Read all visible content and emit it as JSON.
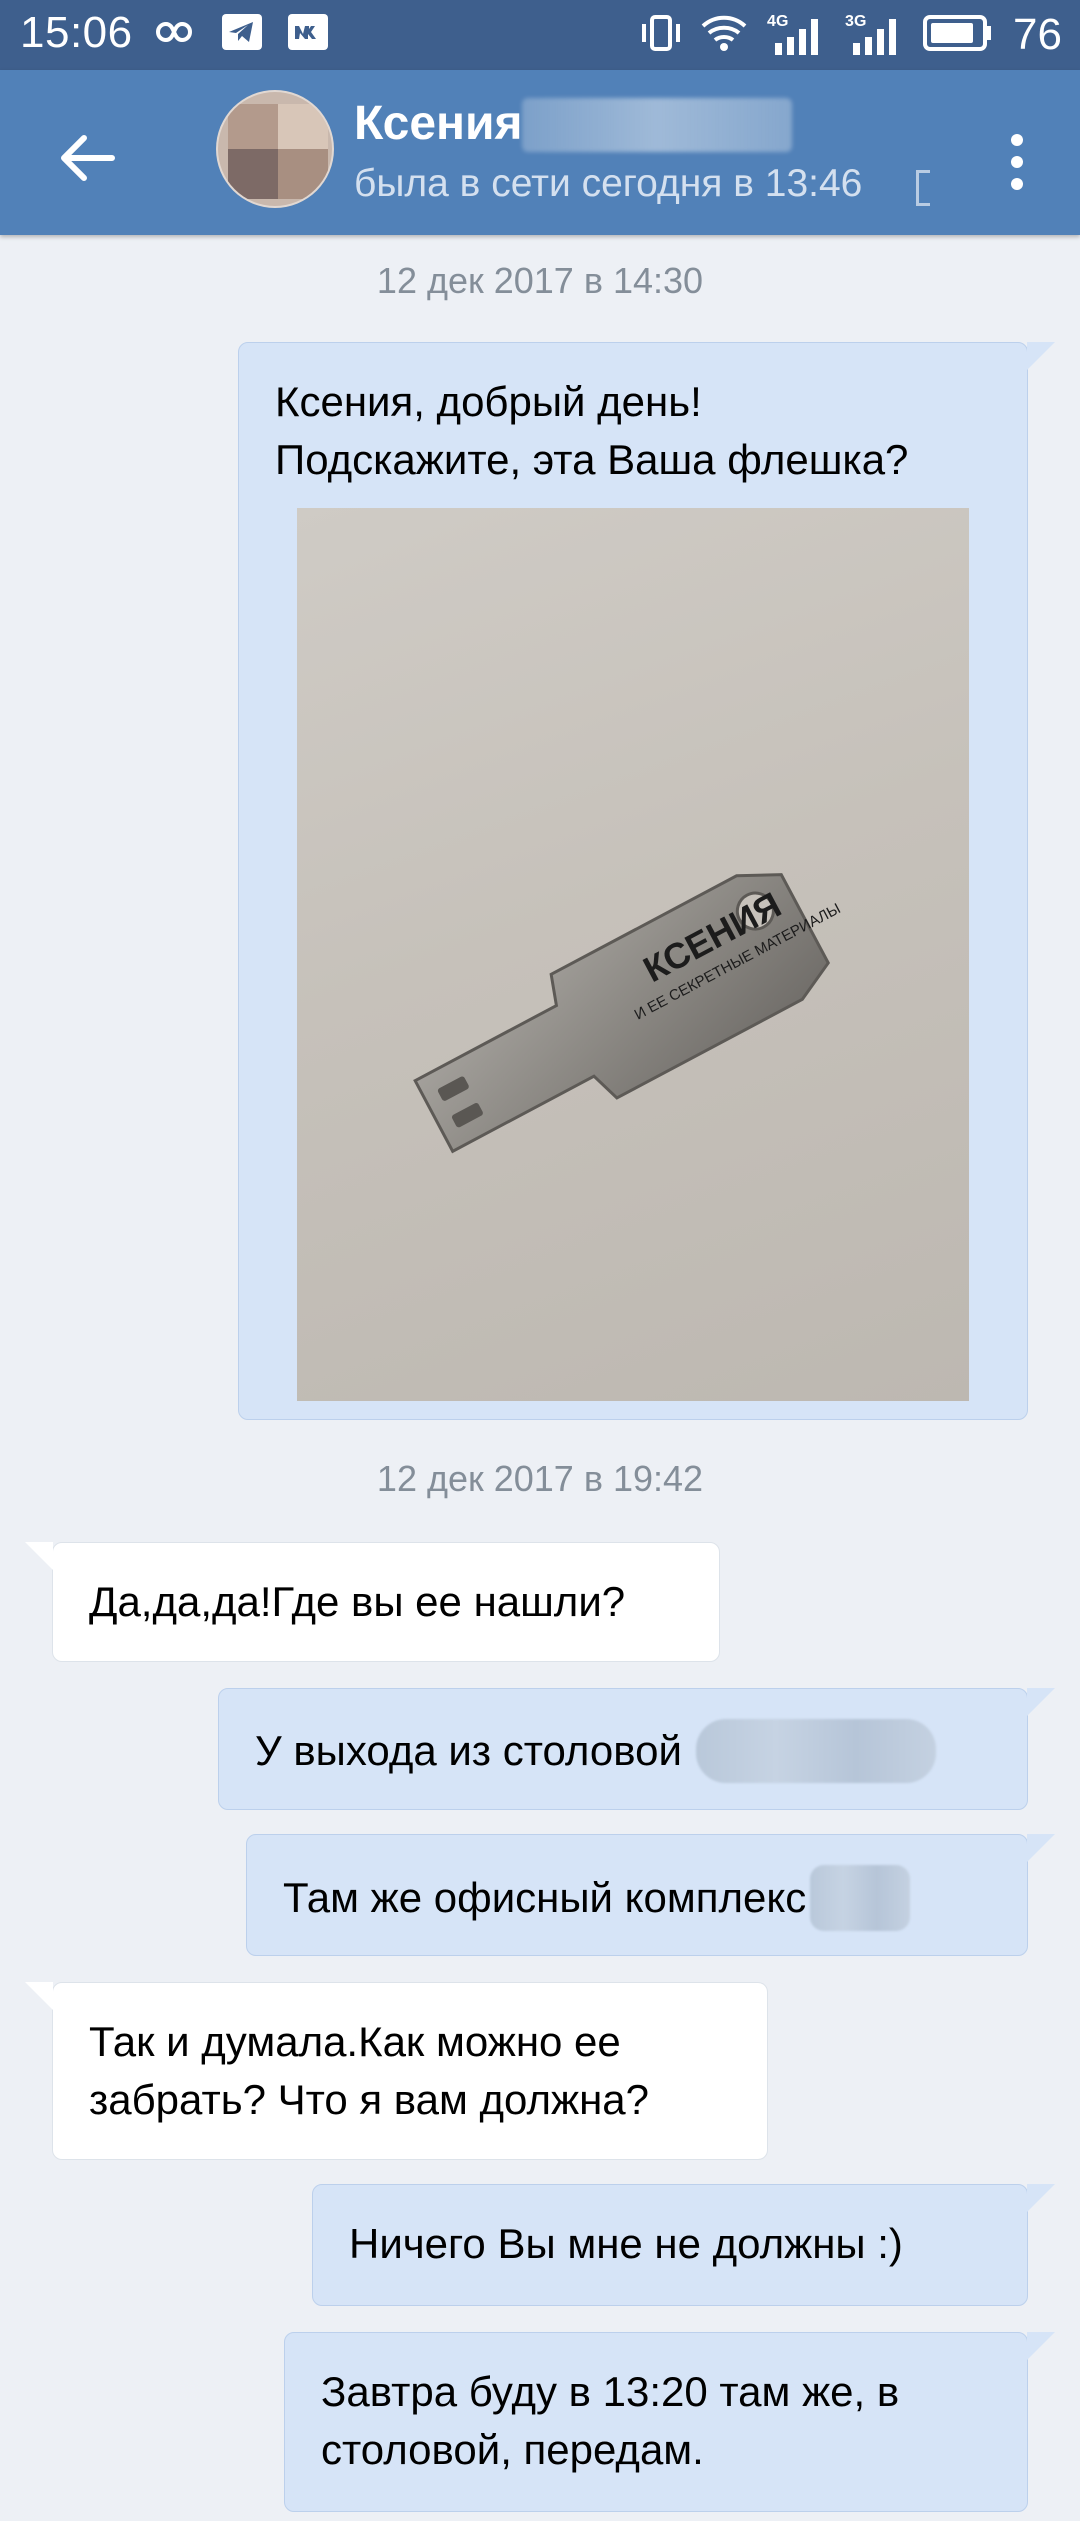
{
  "status_bar": {
    "time": "15:06",
    "net_4g": "4G",
    "net_3g": "3G",
    "battery_percent": "76",
    "icons": [
      "infinity-icon",
      "telegram-icon",
      "vk-icon",
      "vibrate-icon",
      "wifi-icon",
      "signal-4g-icon",
      "signal-3g-icon",
      "battery-icon"
    ]
  },
  "header": {
    "contact_name": "Ксения",
    "contact_status": "была в сети сегодня в 13:46",
    "colors": {
      "toolbar": "#5181b8",
      "status_bar": "#3e5f8d"
    }
  },
  "chat": {
    "date_1": "12 дек 2017 в 14:30",
    "date_2": "12 дек 2017 в 19:42",
    "messages": [
      {
        "direction": "out",
        "text": "Ксения, добрый день!\nПодскажите, эта Ваша флешка?",
        "has_photo": true
      },
      {
        "direction": "in",
        "text": "Да,да,да!Где вы ее нашли?"
      },
      {
        "direction": "out",
        "text": "У выхода из столовой"
      },
      {
        "direction": "out",
        "text": "Там же офисный комплекс"
      },
      {
        "direction": "in",
        "text": "Так и думала.Как можно ее\nзабрать? Что я вам должна?"
      },
      {
        "direction": "out",
        "text": "Ничего Вы мне не должны :)"
      },
      {
        "direction": "out",
        "text": "Завтра буду в 13:20 там же, в\nстоловой, передам."
      }
    ],
    "photo": {
      "engraving_main": "КСЕНИЯ",
      "engraving_sub": "И ЕЕ СЕКРЕТНЫЕ МАТЕРИАЛЫ"
    },
    "colors": {
      "background": "#edf0f5",
      "outgoing": "#d6e4f7",
      "incoming": "#ffffff"
    }
  }
}
